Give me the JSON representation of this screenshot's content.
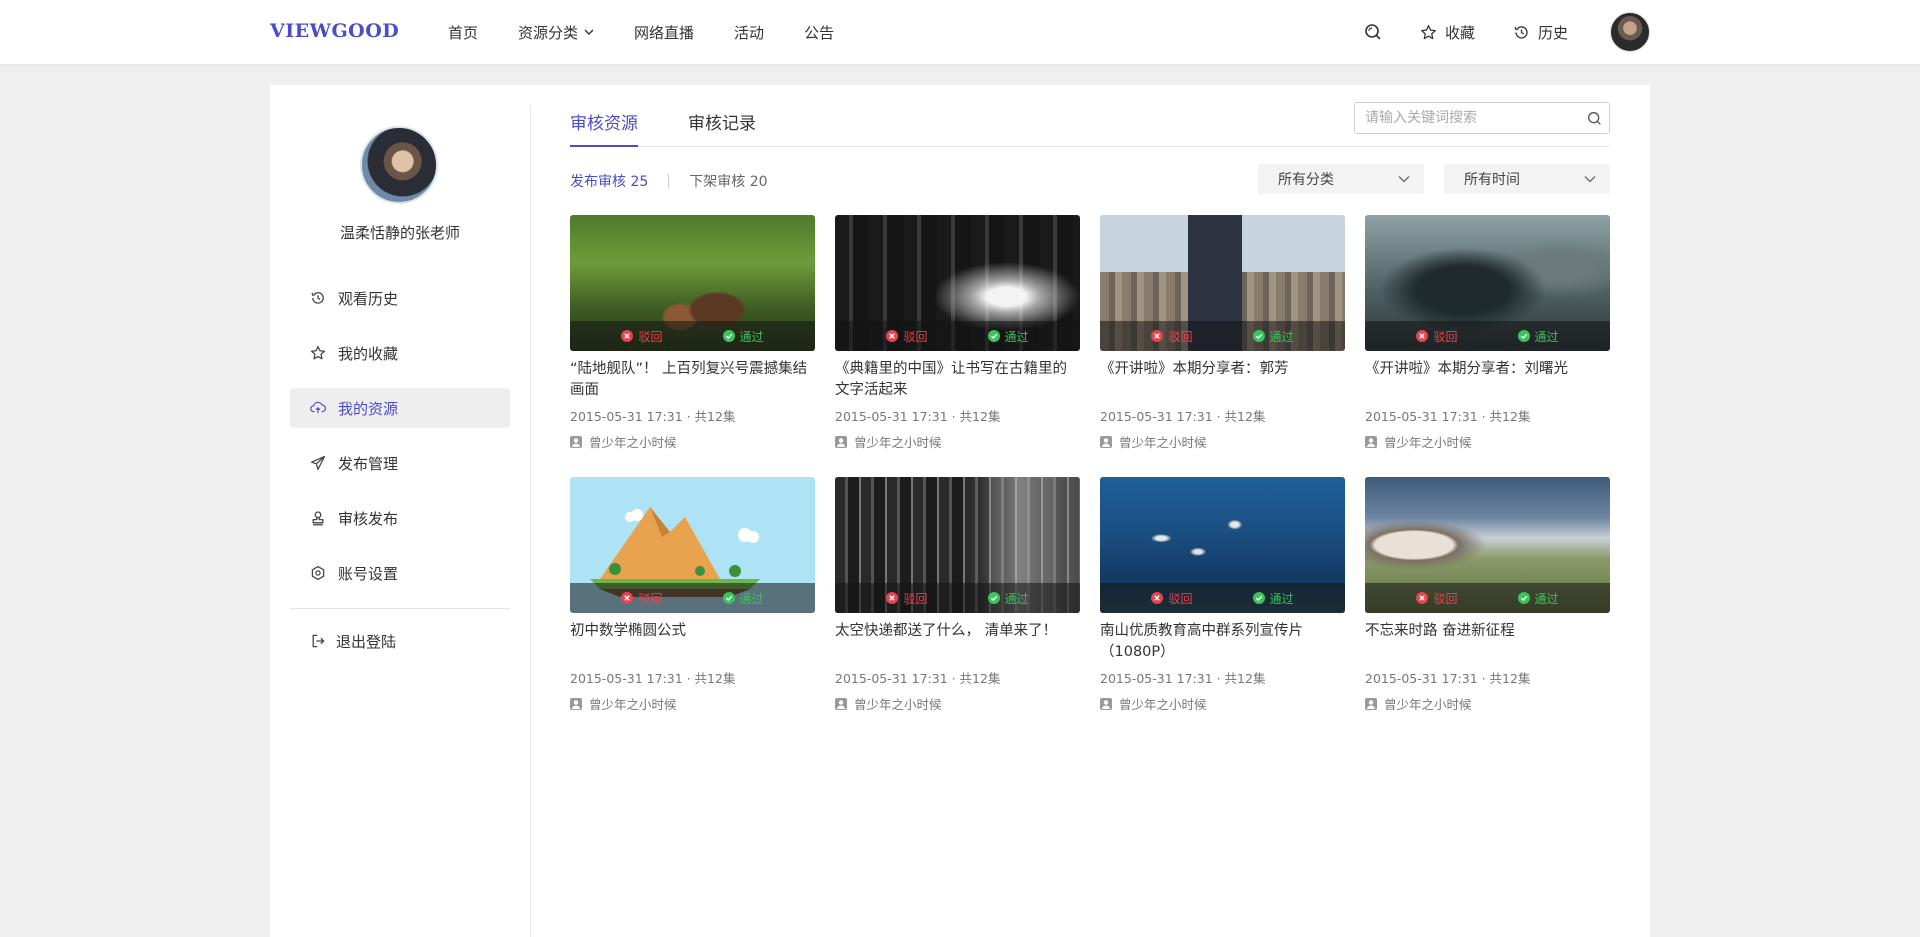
{
  "header": {
    "logo": "VIEWGOOD",
    "nav": [
      {
        "label": "首页"
      },
      {
        "label": "资源分类"
      },
      {
        "label": "网络直播"
      },
      {
        "label": "活动"
      },
      {
        "label": "公告"
      }
    ],
    "favorites_label": "收藏",
    "history_label": "历史"
  },
  "sidebar": {
    "user_name": "温柔恬静的张老师",
    "items": [
      {
        "label": "观看历史",
        "icon": "history-icon"
      },
      {
        "label": "我的收藏",
        "icon": "star-icon"
      },
      {
        "label": "我的资源",
        "icon": "cloud-upload-icon",
        "active": true
      },
      {
        "label": "发布管理",
        "icon": "send-icon"
      },
      {
        "label": "审核发布",
        "icon": "stamp-icon"
      },
      {
        "label": "账号设置",
        "icon": "settings-icon"
      }
    ],
    "logout_label": "退出登陆"
  },
  "main": {
    "tabs": [
      {
        "label": "审核资源",
        "active": true
      },
      {
        "label": "审核记录"
      }
    ],
    "search": {
      "placeholder": "请输入关键词搜索",
      "value": ""
    },
    "subtabs": [
      {
        "label": "发布审核 25",
        "active": true
      },
      {
        "label": "下架审核 20"
      }
    ],
    "filters": {
      "category": "所有分类",
      "time": "所有时间"
    },
    "reject_label": "驳回",
    "pass_label": "通过",
    "cards": [
      {
        "title": "“陆地舰队”！ 上百列复兴号震撼集结画面",
        "meta": "2015-05-31 17:31 · 共12集",
        "author": "曾少年之小时候",
        "thumb": "squirrel"
      },
      {
        "title": "《典籍里的中国》让书写在古籍里的文字活起来",
        "meta": "2015-05-31 17:31 · 共12集",
        "author": "曾少年之小时候",
        "thumb": "fire"
      },
      {
        "title": "《开讲啦》本期分享者：郭芳",
        "meta": "2015-05-31 17:31 · 共12集",
        "author": "曾少年之小时候",
        "thumb": "city"
      },
      {
        "title": "《开讲啦》本期分享者：刘曙光",
        "meta": "2015-05-31 17:31 · 共12集",
        "author": "曾少年之小时候",
        "thumb": "poster"
      },
      {
        "title": "初中数学椭圆公式",
        "meta": "2015-05-31 17:31 · 共12集",
        "author": "曾少年之小时候",
        "thumb": "mountain"
      },
      {
        "title": "太空快递都送了什么， 清单来了！",
        "meta": "2015-05-31 17:31 · 共12集",
        "author": "曾少年之小时候",
        "thumb": "night"
      },
      {
        "title": "南山优质教育高中群系列宣传片（1080P）",
        "meta": "2015-05-31 17:31 · 共12集",
        "author": "曾少年之小时候",
        "thumb": "ocean"
      },
      {
        "title": "不忘来时路 奋进新征程",
        "meta": "2015-05-31 17:31 · 共12集",
        "author": "曾少年之小时候",
        "thumb": "wolf"
      }
    ]
  },
  "colors": {
    "accent": "#4a4cc9",
    "reject": "#e8434f",
    "pass": "#39c45c"
  }
}
